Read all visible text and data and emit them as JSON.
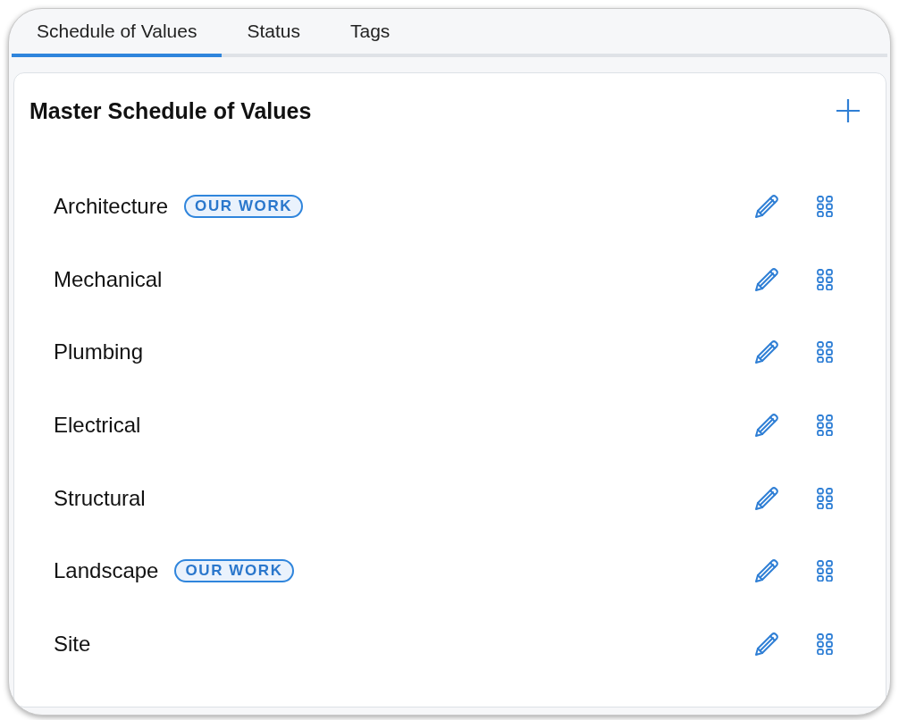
{
  "tabs": [
    {
      "label": "Schedule of Values",
      "selected": true
    },
    {
      "label": "Status",
      "selected": false
    },
    {
      "label": "Tags",
      "selected": false
    }
  ],
  "panel": {
    "title": "Master Schedule of Values"
  },
  "items": [
    {
      "name": "Architecture",
      "badge": "OUR WORK"
    },
    {
      "name": "Mechanical"
    },
    {
      "name": "Plumbing"
    },
    {
      "name": "Electrical"
    },
    {
      "name": "Structural"
    },
    {
      "name": "Landscape",
      "badge": "OUR WORK"
    },
    {
      "name": "Site"
    }
  ]
}
